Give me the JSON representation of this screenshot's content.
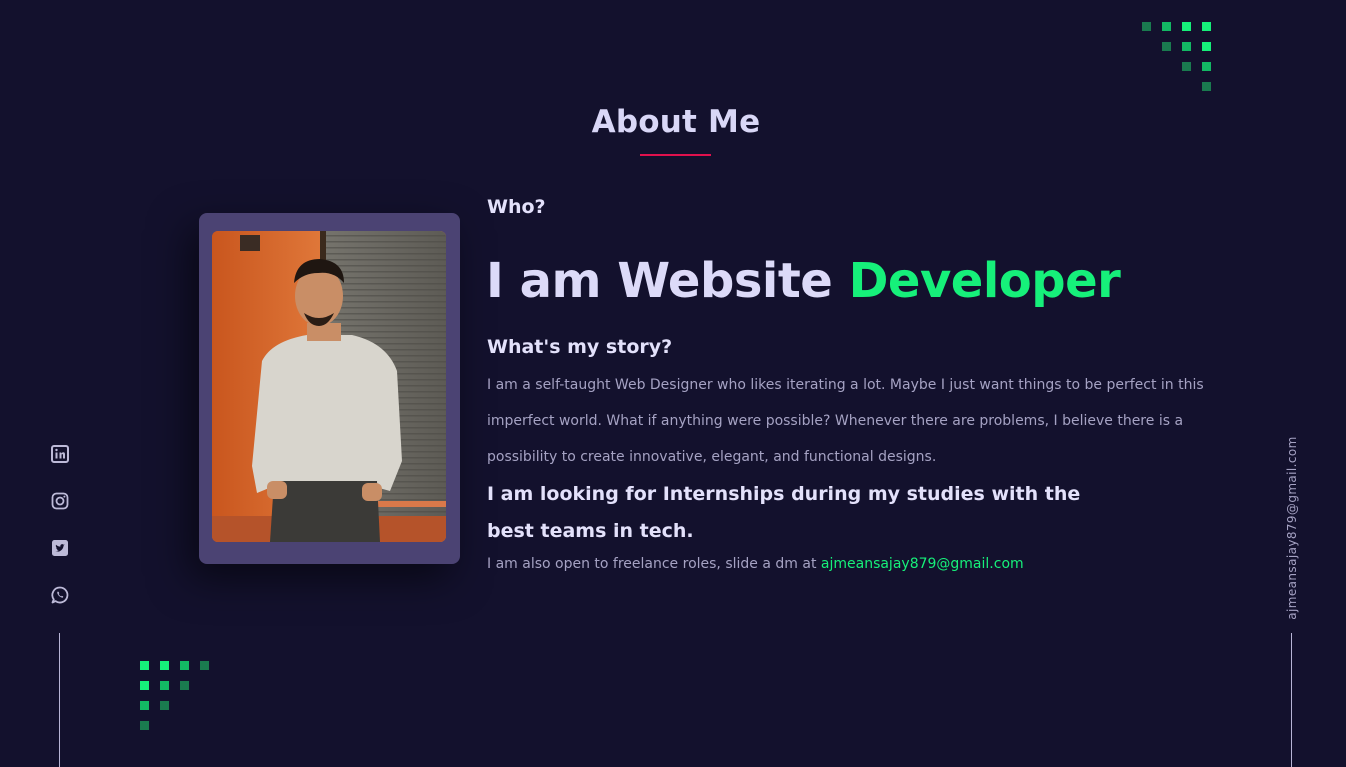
{
  "section": {
    "title": "About Me"
  },
  "about": {
    "who": "Who?",
    "headline_prefix": "I am Website ",
    "headline_accent": "Developer",
    "story_title": "What's my story?",
    "story_text": "I am a self-taught Web Designer who likes iterating a lot. Maybe I just want things to be perfect in this imperfect world. What if anything were possible? Whenever there are problems, I believe there is a possibility to create innovative, elegant, and functional designs.",
    "looking_text": "I am looking for Internships during my studies with the best teams in tech.",
    "freelance_prefix": "I am also open to freelance roles, slide a dm at ",
    "freelance_email": "ajmeansajay879@gmail.com"
  },
  "sidebar": {
    "email": "ajmeansajay879@gmail.com",
    "social": [
      "linkedin-icon",
      "instagram-icon",
      "twitter-icon",
      "whatsapp-icon"
    ]
  },
  "colors": {
    "background": "#13112d",
    "accent_green": "#16f07a",
    "accent_red": "#e0114d",
    "frame": "#4b4373",
    "heading_text": "#dcdaf8",
    "body_text": "#a5a2c3"
  }
}
